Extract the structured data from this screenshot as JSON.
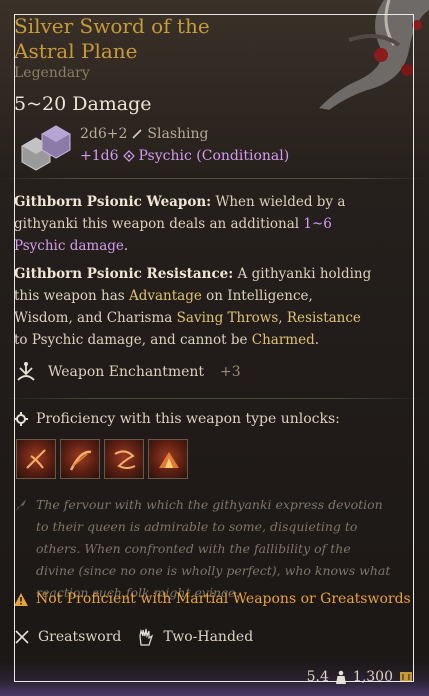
{
  "item": {
    "title": "Silver Sword of the Astral Plane",
    "rarity": "Legendary",
    "damage": "5~20 Damage",
    "damage_primary": "2d6+2",
    "damage_primary_type": "Slashing",
    "damage_bonus": "+1d6",
    "damage_bonus_type": "Psychic (Conditional)"
  },
  "passives": [
    {
      "name": "Githborn Psionic Weapon:",
      "text_a": " When wielded by a githyanki this weapon deals an additional ",
      "highlight": "1~6 Psychic damage",
      "text_b": "."
    },
    {
      "name": "Githborn Psionic Resistance:",
      "text_a": " A githyanki holding this weapon has ",
      "kw1": "Advantage",
      "text_b": " on Intelligence, Wisdom, and Charisma ",
      "kw2": "Saving Throws",
      "text_c": ", ",
      "kw3": "Resistance",
      "text_d": " to Psychic damage, and cannot be ",
      "kw4": "Charmed",
      "text_e": "."
    }
  ],
  "enchantment": {
    "label": "Weapon Enchantment",
    "value": "+3"
  },
  "proficiency": {
    "label": "Proficiency with this weapon type unlocks:"
  },
  "skills": [
    {
      "icon": "flourish-icon"
    },
    {
      "icon": "slash-icon"
    },
    {
      "icon": "lacerate-icon"
    },
    {
      "icon": "cleave-icon"
    }
  ],
  "lore": "The fervour with which the githyanki express devotion to their queen is admirable to some, disquieting to others. When confronted with the fallibility of the divine (since no one is wholly perfect), who knows what reaction such folk might evince.",
  "warning": {
    "not_proficient": "Not Proficient",
    "rest_pre": " with ",
    "rest_kw": "Martial Weapons or Greatswords"
  },
  "tags": [
    {
      "label": "Greatsword",
      "icon": "crossed-swords-icon"
    },
    {
      "label": "Two-Handed",
      "icon": "hand-icon"
    }
  ],
  "footer": {
    "weight": "5.4",
    "price": "1,300"
  },
  "colors": {
    "title": "#c79a3a",
    "psychic": "#d49cf0",
    "keyword": "#e0c173",
    "warning": "#e6a33a"
  }
}
